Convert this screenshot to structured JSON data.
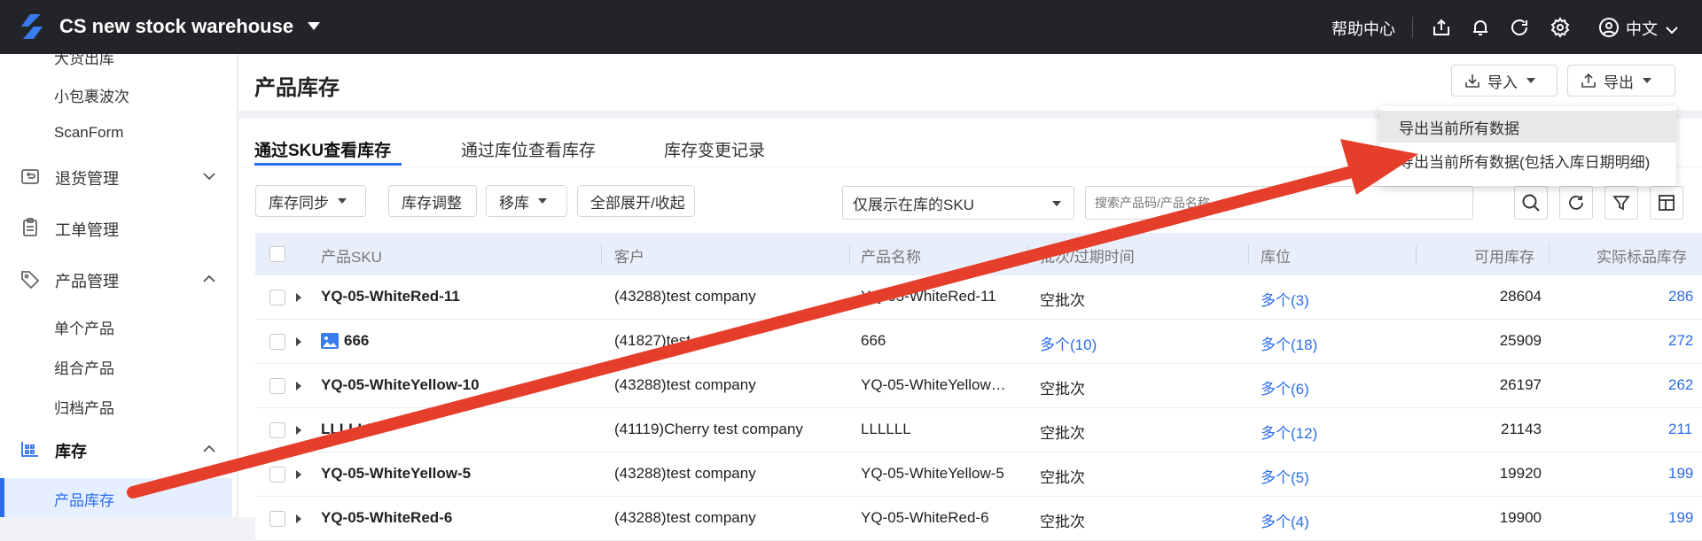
{
  "header": {
    "app_title": "CS new stock warehouse",
    "help_label": "帮助中心",
    "language_label": "中文"
  },
  "sidebar": {
    "sub_top": [
      "大货出库",
      "小包裹波次",
      "ScanForm"
    ],
    "groups": [
      {
        "label": "退货管理",
        "icon": "return-icon",
        "expanded": false
      },
      {
        "label": "工单管理",
        "icon": "clipboard-icon"
      },
      {
        "label": "产品管理",
        "icon": "tag-icon",
        "expanded": true
      },
      {
        "label": "库存",
        "icon": "inventory-icon",
        "expanded": true
      }
    ],
    "product_items": [
      "单个产品",
      "组合产品",
      "归档产品"
    ],
    "inventory_items": [
      "产品库存"
    ],
    "active_item": "产品库存"
  },
  "page": {
    "title": "产品库存",
    "import_label": "导入",
    "export_label": "导出"
  },
  "export_menu": {
    "items": [
      "导出当前所有数据",
      "导出当前所有数据(包括入库日期明细)"
    ],
    "hovered_index": 0
  },
  "tabs": [
    {
      "label": "通过SKU查看库存",
      "active": true
    },
    {
      "label": "通过库位查看库存",
      "active": false
    },
    {
      "label": "库存变更记录",
      "active": false
    }
  ],
  "toolbar": {
    "sync_label": "库存同步",
    "adjust_label": "库存调整",
    "move_label": "移库",
    "expand_label": "全部展开/收起",
    "filter_select": "仅展示在库的SKU",
    "search_placeholder": "搜索产品码/产品名称"
  },
  "table": {
    "columns": [
      "产品SKU",
      "客户",
      "产品名称",
      "批次/过期时间",
      "库位",
      "可用库存",
      "实际标品库存"
    ],
    "rows": [
      {
        "sku": "YQ-05-WhiteRed-11",
        "has_image": false,
        "customer": "(43288)test company",
        "name": "YQ-05-WhiteRed-11",
        "batch": "空批次",
        "batch_link": false,
        "location": "多个(3)",
        "available": "28604",
        "actual": "286"
      },
      {
        "sku": "666",
        "has_image": true,
        "customer": "(41827)test",
        "name": "666",
        "batch": "多个(10)",
        "batch_link": true,
        "location": "多个(18)",
        "available": "25909",
        "actual": "272"
      },
      {
        "sku": "YQ-05-WhiteYellow-10",
        "has_image": false,
        "customer": "(43288)test company",
        "name": "YQ-05-WhiteYellow…",
        "batch": "空批次",
        "batch_link": false,
        "location": "多个(6)",
        "available": "26197",
        "actual": "262"
      },
      {
        "sku": "LLLLLL",
        "has_image": false,
        "customer": "(41119)Cherry test company",
        "name": "LLLLLL",
        "batch": "空批次",
        "batch_link": false,
        "location": "多个(12)",
        "available": "21143",
        "actual": "211"
      },
      {
        "sku": "YQ-05-WhiteYellow-5",
        "has_image": false,
        "customer": "(43288)test company",
        "name": "YQ-05-WhiteYellow-5",
        "batch": "空批次",
        "batch_link": false,
        "location": "多个(5)",
        "available": "19920",
        "actual": "199"
      },
      {
        "sku": "YQ-05-WhiteRed-6",
        "has_image": false,
        "customer": "(43288)test company",
        "name": "YQ-05-WhiteRed-6",
        "batch": "空批次",
        "batch_link": false,
        "location": "多个(4)",
        "available": "19900",
        "actual": "199"
      }
    ]
  },
  "colors": {
    "topbar": "#222429",
    "accent": "#2b6de8",
    "annotation_arrow": "#e53e2b"
  }
}
